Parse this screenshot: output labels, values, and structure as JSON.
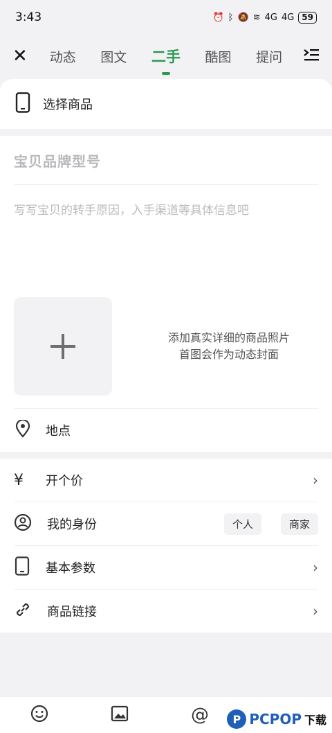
{
  "status": {
    "time": "3:43",
    "signal1": "4G",
    "signal2": "4G",
    "battery": "59"
  },
  "nav": {
    "tabs": [
      {
        "label": "动态"
      },
      {
        "label": "图文"
      },
      {
        "label": "二手",
        "active": true
      },
      {
        "label": "酷图"
      },
      {
        "label": "提问"
      }
    ]
  },
  "select_goods": {
    "label": "选择商品"
  },
  "form": {
    "title_placeholder": "宝贝品牌型号",
    "desc_placeholder": "写写宝贝的转手原因，入手渠道等具体信息吧",
    "photo_hint_line1": "添加真实详细的商品照片",
    "photo_hint_line2": "首图会作为动态封面",
    "location_label": "地点"
  },
  "options": {
    "price_label": "开个价",
    "identity_label": "我的身份",
    "identity_personal": "个人",
    "identity_merchant": "商家",
    "params_label": "基本参数",
    "link_label": "商品链接"
  },
  "watermark": {
    "brand": "PCPOP",
    "suffix": "下载"
  },
  "colors": {
    "accent": "#2a9a4f"
  }
}
